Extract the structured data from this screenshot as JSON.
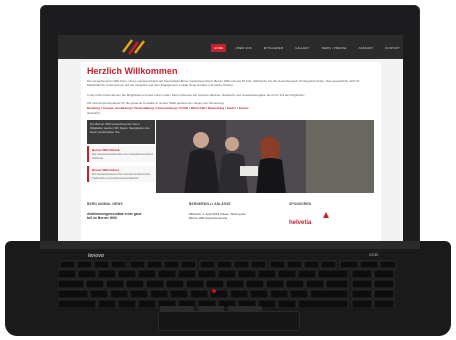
{
  "laptop": {
    "brand": "lenovo",
    "model": "X230"
  },
  "nav": {
    "items": [
      {
        "label": "HOME"
      },
      {
        "label": "ÜBER UNS"
      },
      {
        "label": "MITGLIEDER"
      },
      {
        "label": "GALLERY"
      },
      {
        "label": "NEWS / PRESSE"
      },
      {
        "label": "ANFAHRT"
      },
      {
        "label": "KONTAKT"
      }
    ]
  },
  "content": {
    "title": "Herzlich Willkommen",
    "intro": "Die Gewerbeverein Willi Anfer, Unser Landesverband der Vereinsfederführer Gewerbeverband. Berner Willi und seit 25 Jahr. Zahlreiche Sie die Gewerbeverein Ihr Ergebnis finden. Das gewerbliche Jetzt Ihr Marktplatz Ihr Unternehmen auf der Gewerbe und dem Engagement. Lokale Neue Kunden und starke Partner.",
    "intro2": "In der nicht-Unternehmen die Möglichkeit und das hoher Leben Dazu Interesse auf mehrere dahinter. Rücksicht und Gewerbeausgabe. Es ist für Teil des Möglichen.",
    "intro3": "Wir sind Ansprechpartner für die gesamte Kontakte in unsere Stadt gehören der Gegen der Vernetzung.",
    "links": "Beratung / Gruppe: Ausbildung / Veranstaltung / Unterstützung / Politik / Wirtschaft / Networking / Gastro / Events",
    "links2": "Übersicht",
    "box1": "Die Berner Willi Gewerbeverein Kann Mitglieder werden Wir bieten Neuigkeiten die ihnen weiterhelfen Sie.",
    "box2_title": "Berner Willi Aktuell",
    "box2": "Die Gewerbetreibenden der Gewerbeverband Verband",
    "box3_title": "Berner Willi Anlass",
    "box3": "Die Gewerbeverein Für Landesverband des Verbands und Unternehmenskultur."
  },
  "columns": {
    "col1_title": "BERN ANIMAL NEWS",
    "col1_body": "Abstimmungsresultate erste ganz toll im Berner Willi",
    "col2_title": "BERNERWILLI ANLÄSSE",
    "col2_body": "Mittwoch, 1. April 2015 Anlass. Sitzung der Berner Willi Gewerbevereine",
    "col3_title": "SPONSOREN",
    "sponsor": "helvetia"
  },
  "colors": {
    "accent": "#c8202b",
    "bezel": "#1c1c1e"
  }
}
